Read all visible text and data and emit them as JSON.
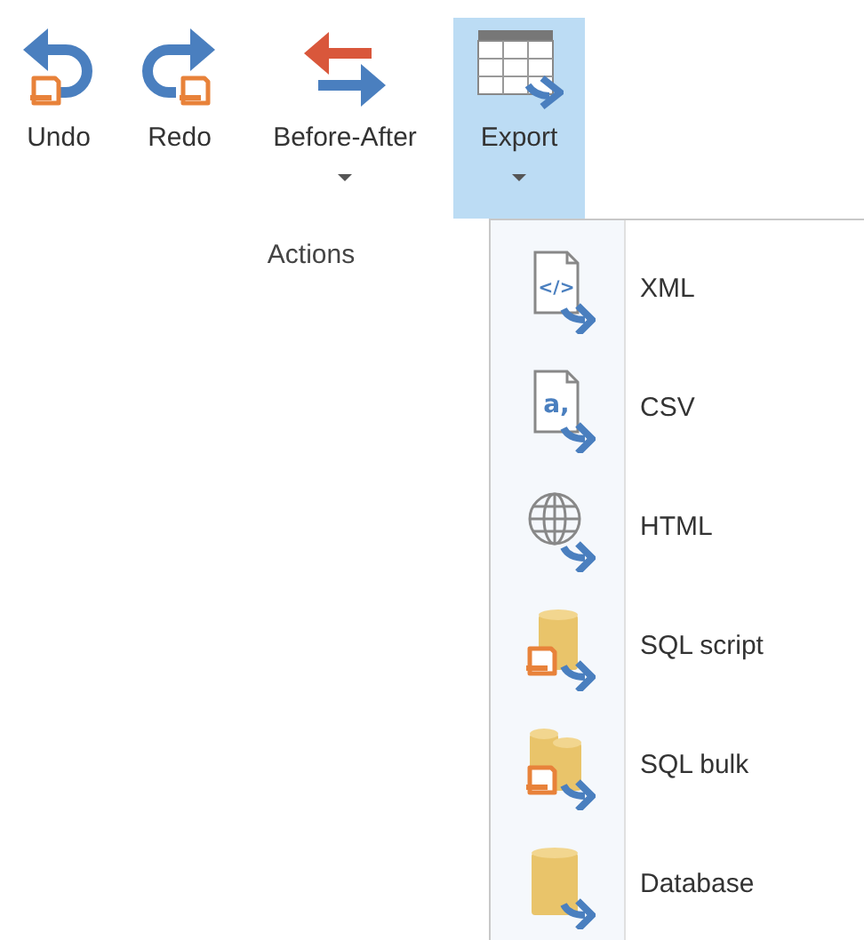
{
  "ribbon": {
    "buttons": [
      {
        "label": "Undo",
        "kind": "undo",
        "dropdown": false,
        "selected": false
      },
      {
        "label": "Redo",
        "kind": "redo",
        "dropdown": false,
        "selected": false
      },
      {
        "label": "Before-After",
        "kind": "swap",
        "dropdown": true,
        "selected": false
      },
      {
        "label": "Export",
        "kind": "export",
        "dropdown": true,
        "selected": true
      }
    ],
    "group_label": "Actions"
  },
  "export_menu": {
    "items": [
      {
        "label": "XML",
        "kind": "xml",
        "glyph": "</>"
      },
      {
        "label": "CSV",
        "kind": "csv",
        "glyph": "a,"
      },
      {
        "label": "HTML",
        "kind": "html"
      },
      {
        "label": "SQL script",
        "kind": "sqlscript"
      },
      {
        "label": "SQL bulk",
        "kind": "sqlbulk"
      },
      {
        "label": "Database",
        "kind": "database"
      }
    ]
  }
}
